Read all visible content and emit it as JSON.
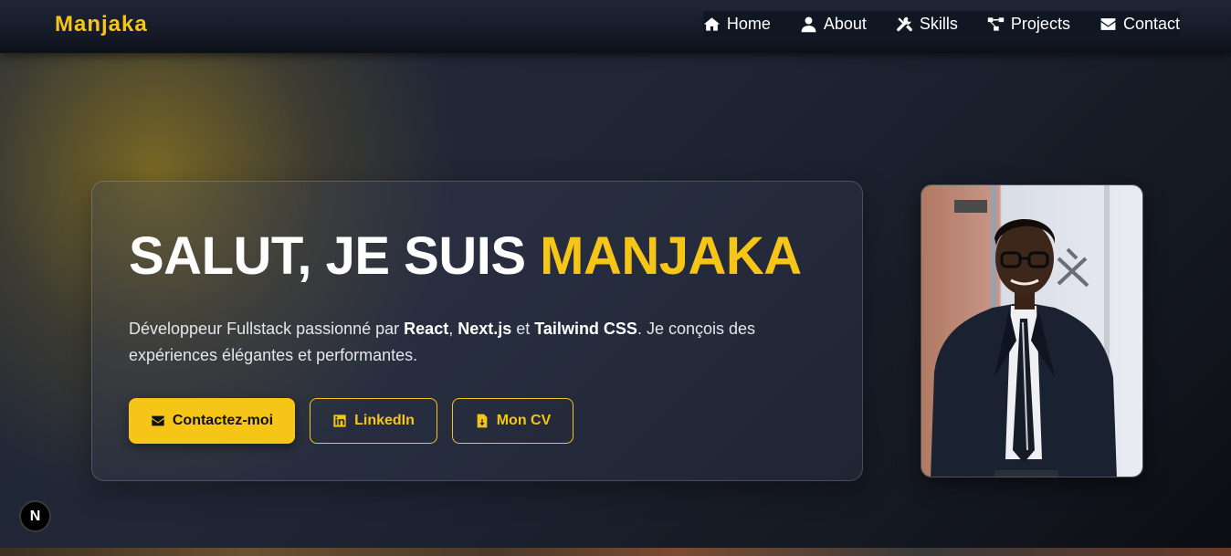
{
  "brand": {
    "name": "Manjaka"
  },
  "nav": {
    "items": [
      {
        "label": "Home",
        "icon": "home-icon"
      },
      {
        "label": "About",
        "icon": "user-icon"
      },
      {
        "label": "Skills",
        "icon": "tools-icon"
      },
      {
        "label": "Projects",
        "icon": "diagram-icon"
      },
      {
        "label": "Contact",
        "icon": "envelope-icon"
      }
    ]
  },
  "hero": {
    "title_prefix": "SALUT, JE SUIS ",
    "title_name": "MANJAKA",
    "desc_part1": "Développeur Fullstack passionné par ",
    "desc_tech1": "React",
    "desc_sep1": ", ",
    "desc_tech2": "Next.js",
    "desc_sep2": " et ",
    "desc_tech3": "Tailwind CSS",
    "desc_part2": ". Je conçois des expériences élégantes et performantes.",
    "buttons": {
      "contact": "Contactez-moi",
      "linkedin": "LinkedIn",
      "cv": "Mon CV"
    }
  },
  "badge": {
    "label": "N"
  },
  "colors": {
    "accent": "#f5c518",
    "background": "#1c2232",
    "navbar": "#141925"
  }
}
